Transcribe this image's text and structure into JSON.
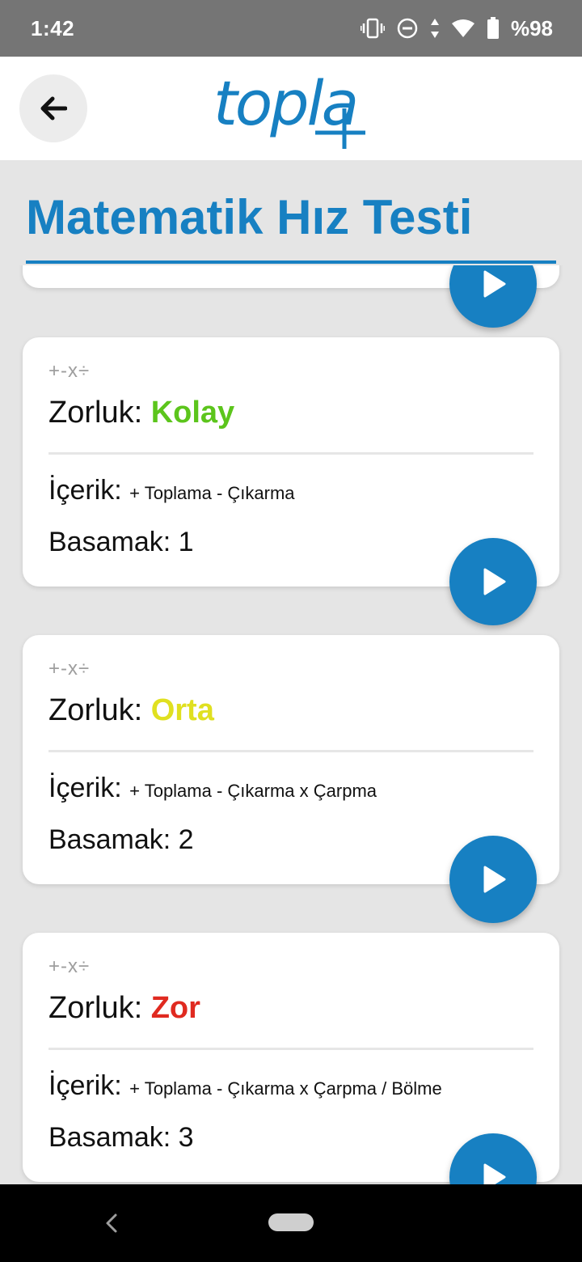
{
  "status_bar": {
    "time": "1:42",
    "battery": "%98",
    "icons": [
      "vibrate-icon",
      "dnd-icon",
      "data-arrows-icon",
      "wifi-icon",
      "battery-icon"
    ]
  },
  "app_bar": {
    "logo_text": "topla",
    "back_icon": "arrow-left-icon"
  },
  "page": {
    "title": "Matematik Hız Testi"
  },
  "colors": {
    "accent": "#1780c2",
    "kolay": "#5cc51c",
    "orta": "#e0e020",
    "zor": "#e02a20"
  },
  "cards": [
    {
      "ops": "+-x÷",
      "zorluk_label": "Zorluk:",
      "level": "Kolay",
      "icerik_label": "İçerik:",
      "icerik": "+ Toplama - Çıkarma",
      "basamak": "Basamak: 1"
    },
    {
      "ops": "+-x÷",
      "zorluk_label": "Zorluk:",
      "level": "Orta",
      "icerik_label": "İçerik:",
      "icerik": "+ Toplama - Çıkarma x Çarpma",
      "basamak": "Basamak: 2"
    },
    {
      "ops": "+-x÷",
      "zorluk_label": "Zorluk:",
      "level": "Zor",
      "icerik_label": "İçerik:",
      "icerik": "+ Toplama - Çıkarma x Çarpma / Bölme",
      "basamak": "Basamak: 3"
    }
  ]
}
